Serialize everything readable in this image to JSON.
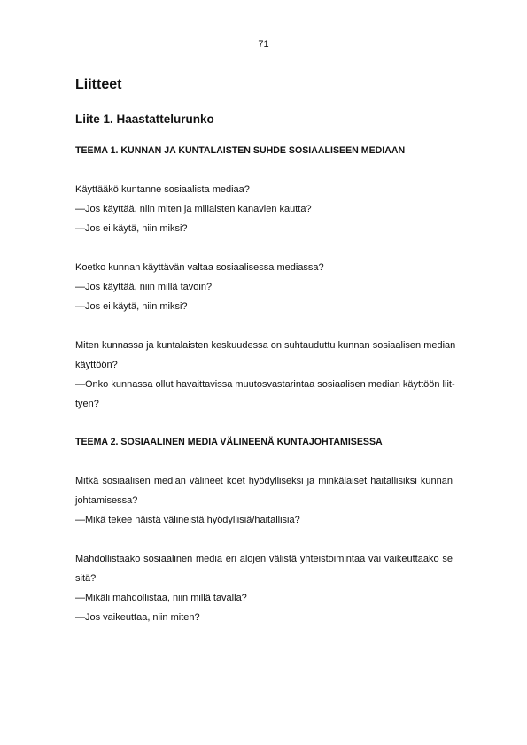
{
  "page_number": "71",
  "heading": "Liitteet",
  "subheading": "Liite 1. Haastattelurunko",
  "theme1": {
    "title": "TEEMA 1. KUNNAN JA KUNTALAISTEN SUHDE SOSIAALISEEN MEDIAAN",
    "q1": "Käyttääkö kuntanne sosiaalista mediaa?",
    "q1a": "—Jos käyttää, niin miten ja millaisten kanavien kautta?",
    "q1b": "—Jos ei käytä, niin miksi?",
    "q2": "Koetko kunnan käyttävän valtaa sosiaalisessa mediassa?",
    "q2a": "—Jos käyttää, niin millä tavoin?",
    "q2b": "—Jos ei käytä, niin miksi?",
    "q3_l1": "Miten kunnassa ja kuntalaisten keskuudessa on suhtauduttu kunnan sosiaalisen median",
    "q3_l2": "käyttöön?",
    "q3a_l1": "—Onko kunnassa ollut havaittavissa muutosvastarintaa sosiaalisen median käyttöön liit-",
    "q3a_l2": "tyen?"
  },
  "theme2": {
    "title": "TEEMA 2. SOSIAALINEN MEDIA VÄLINEENÄ KUNTAJOHTAMISESSA",
    "q1_l1": "Mitkä sosiaalisen median välineet koet hyödylliseksi ja minkälaiset haitallisiksi kunnan",
    "q1_l2": "johtamisessa?",
    "q1a": "—Mikä tekee näistä välineistä hyödyllisiä/haitallisia?",
    "q2_l1": "Mahdollistaako sosiaalinen media eri alojen välistä yhteistoimintaa vai vaikeuttaako se",
    "q2_l2": "sitä?",
    "q2a": "—Mikäli mahdollistaa, niin millä tavalla?",
    "q2b": "—Jos vaikeuttaa, niin miten?"
  }
}
